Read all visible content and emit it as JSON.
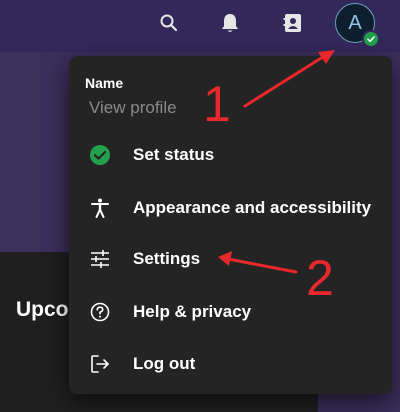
{
  "header": {
    "icons": [
      "search-icon",
      "bell-icon",
      "contacts-icon"
    ],
    "avatar_initial": "A",
    "presence_status": "available",
    "presence_color": "#22a04b"
  },
  "background": {
    "partial_heading": "Upco"
  },
  "profile_menu": {
    "name": "Name",
    "view_profile": "View profile",
    "items": [
      {
        "label": "Set status",
        "icon": "green-check-icon"
      },
      {
        "label": "Appearance and accessibility",
        "icon": "accessibility-icon"
      },
      {
        "label": "Settings",
        "icon": "sliders-icon"
      },
      {
        "label": "Help & privacy",
        "icon": "help-icon"
      },
      {
        "label": "Log out",
        "icon": "log-out-icon"
      }
    ]
  },
  "annotations": {
    "step1": "1",
    "step2": "2",
    "color": "#e8282b"
  }
}
